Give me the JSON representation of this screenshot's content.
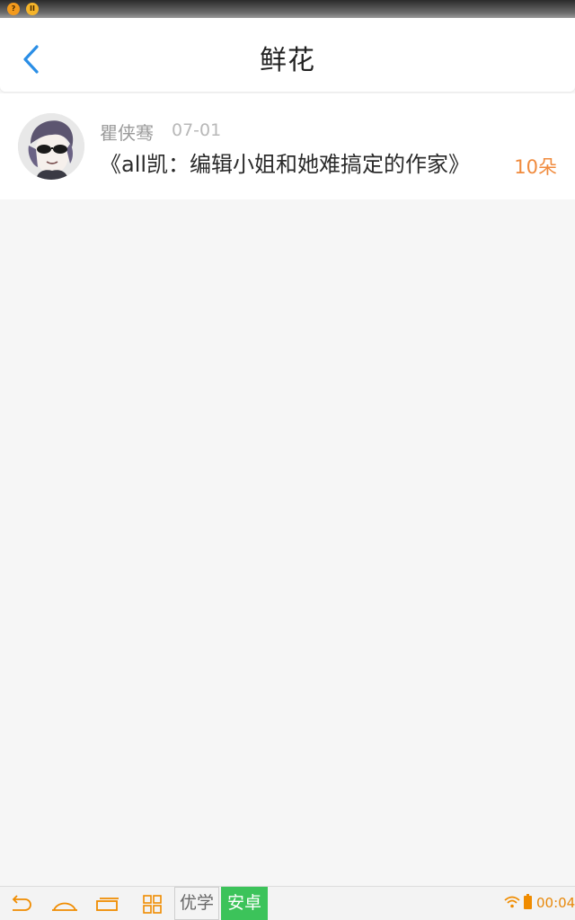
{
  "status_bar": {
    "indicator_1": "?",
    "indicator_2": "II"
  },
  "header": {
    "title": "鲜花"
  },
  "list": [
    {
      "user_name": "瞿侠骞",
      "date": "07-01",
      "book_title": "《all凯：编辑小姐和她难搞定的作家》",
      "flower_count": "10朵"
    }
  ],
  "nav_bar": {
    "tag_1": "优学",
    "tag_2": "安卓",
    "clock": "00:04"
  },
  "colors": {
    "accent_blue": "#2a8ee6",
    "flower_orange": "#f08a3c",
    "tag_green": "#3cc35a"
  }
}
